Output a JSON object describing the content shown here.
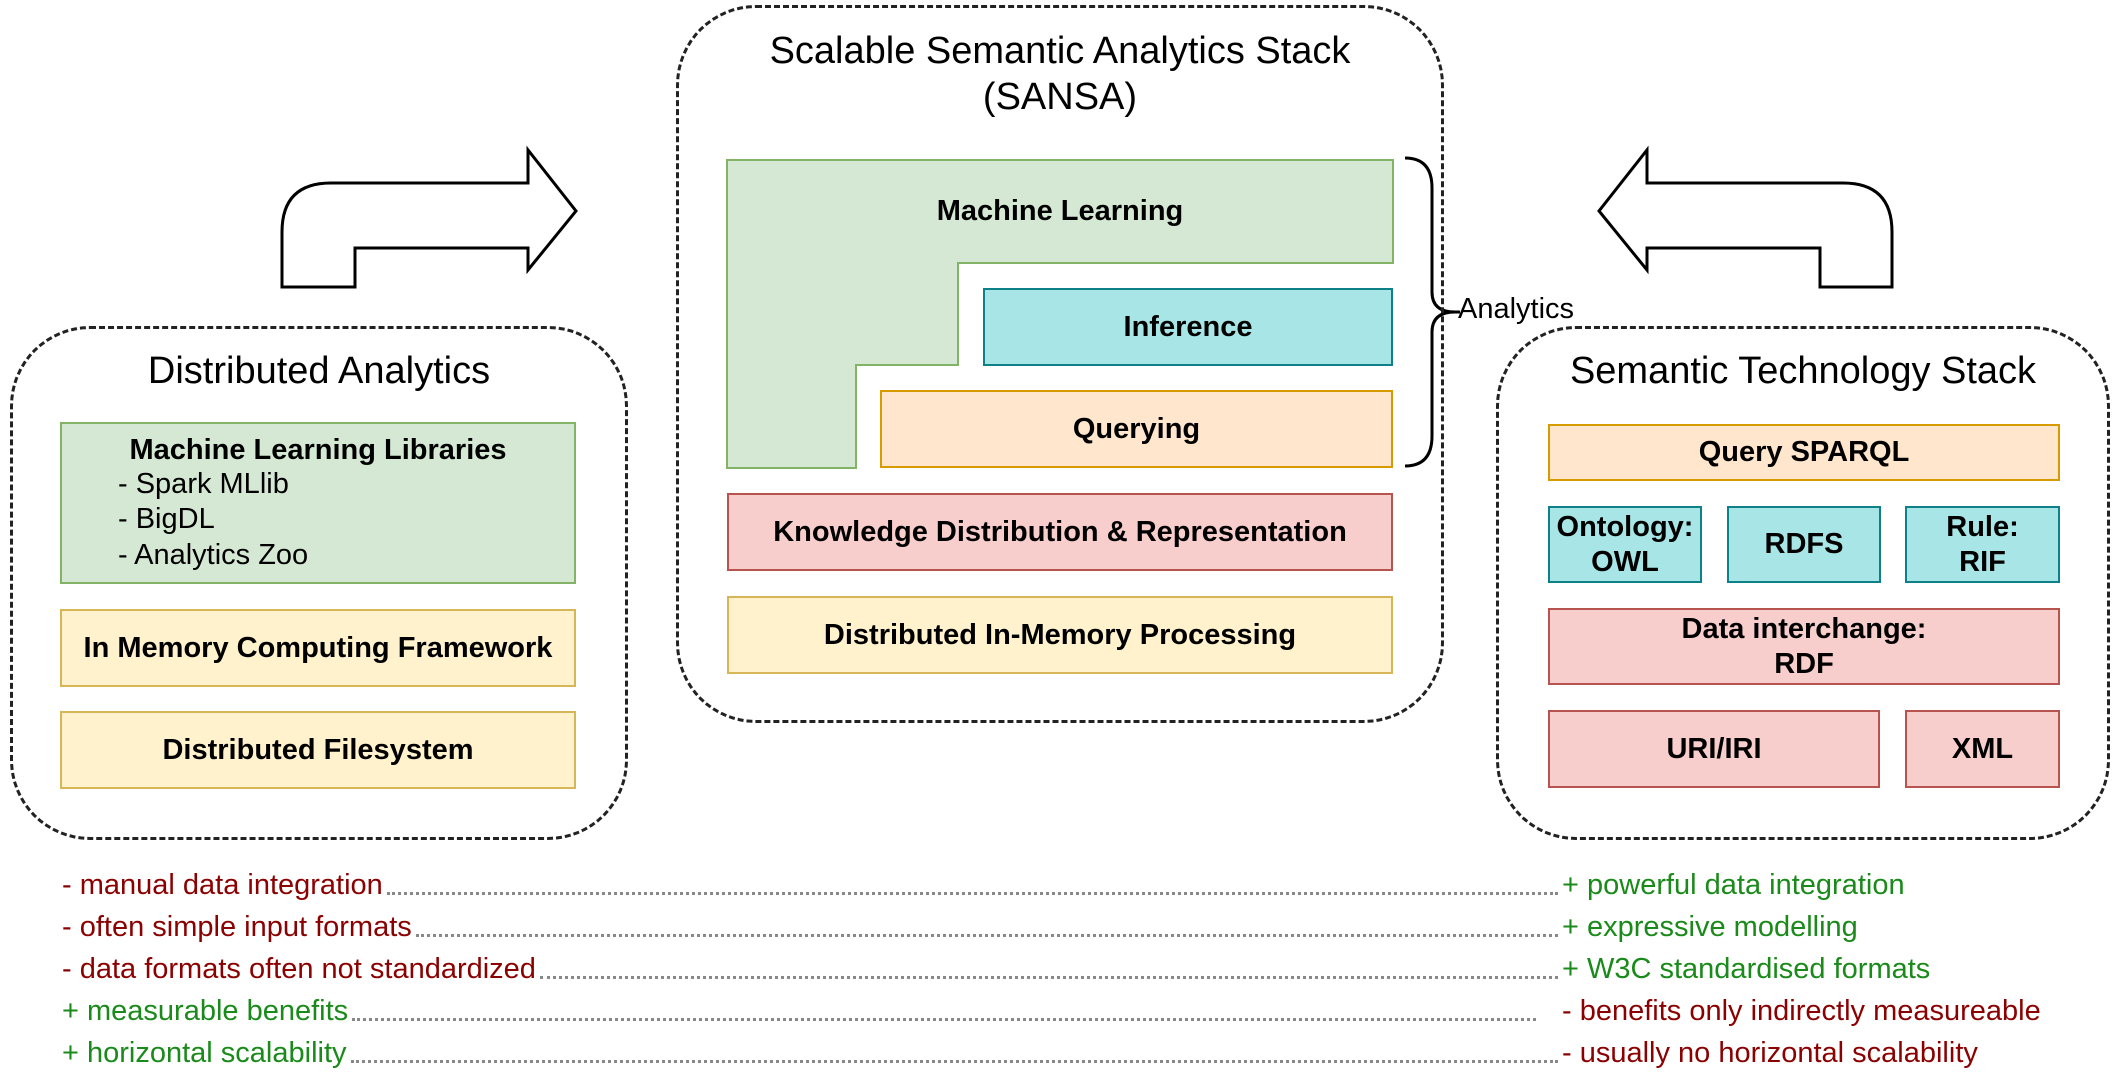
{
  "sansa": {
    "title_line1": "Scalable Semantic Analytics Stack",
    "title_line2": "(SANSA)",
    "layers": {
      "machine_learning": "Machine Learning",
      "inference": "Inference",
      "querying": "Querying",
      "knowledge": "Knowledge Distribution & Representation",
      "processing": "Distributed In-Memory Processing"
    },
    "analytics_label": "Analytics"
  },
  "distributed": {
    "title": "Distributed Analytics",
    "ml_libraries": {
      "title": "Machine Learning Libraries",
      "items": [
        "- Spark MLlib",
        "- BigDL",
        "- Analytics Zoo"
      ]
    },
    "in_memory": "In Memory Computing Framework",
    "filesystem": "Distributed Filesystem"
  },
  "semantic": {
    "title": "Semantic Technology Stack",
    "query": "Query SPARQL",
    "ontology": "Ontology: OWL",
    "rdfs": "RDFS",
    "rule": "Rule: RIF",
    "interchange": "Data interchange: RDF",
    "uri": "URI/IRI",
    "xml": "XML"
  },
  "comparison": {
    "left": [
      "- manual data integration",
      "- often simple input formats",
      "- data formats often not standardized",
      "+ measurable benefits",
      "+ horizontal scalability"
    ],
    "right": [
      "+ powerful data integration",
      "+ expressive modelling",
      "+ W3C standardised formats",
      "- benefits only indirectly measureable",
      "- usually no horizontal scalability"
    ]
  },
  "colors": {
    "green_fill": "#d5e8d4",
    "green_border": "#82b366",
    "cyan_fill": "#a7e5e6",
    "cyan_border": "#0e8088",
    "orange_fill": "#ffe6cc",
    "orange_border": "#d79b00",
    "yellow_fill": "#fff2cc",
    "yellow_border": "#d6b656",
    "red_fill": "#f8cecc",
    "red_border": "#b85450",
    "negative_text": "#8b0000",
    "positive_text": "#1a8a1a"
  }
}
